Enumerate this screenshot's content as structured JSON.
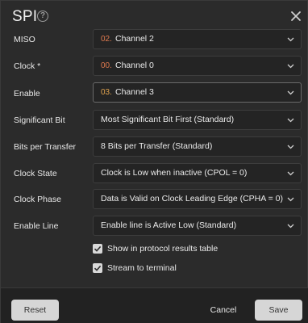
{
  "dialog": {
    "title": "SPI",
    "help_icon": "help-circle-icon",
    "close_icon": "close-icon"
  },
  "fields": {
    "miso": {
      "label": "MISO",
      "number": "02.",
      "value": "Channel 2"
    },
    "clock": {
      "label": "Clock *",
      "number": "00.",
      "value": "Channel 0"
    },
    "enable": {
      "label": "Enable",
      "number": "03.",
      "value": "Channel 3"
    },
    "significant_bit": {
      "label": "Significant Bit",
      "value": "Most Significant Bit First (Standard)"
    },
    "bits_per_transfer": {
      "label": "Bits per Transfer",
      "value": "8 Bits per Transfer (Standard)"
    },
    "clock_state": {
      "label": "Clock State",
      "value": "Clock is Low when inactive (CPOL = 0)"
    },
    "clock_phase": {
      "label": "Clock Phase",
      "value": "Data is Valid on Clock Leading Edge (CPHA = 0)"
    },
    "enable_line": {
      "label": "Enable Line",
      "value": "Enable line is Active Low (Standard)"
    }
  },
  "checkboxes": {
    "show_results": {
      "label": "Show in protocol results table",
      "checked": true
    },
    "stream_terminal": {
      "label": "Stream to terminal",
      "checked": true
    }
  },
  "footer": {
    "reset_label": "Reset",
    "cancel_label": "Cancel",
    "save_label": "Save"
  },
  "colors": {
    "channel_2": "#e07a4f",
    "channel_0": "#e07a4f",
    "channel_3": "#e0a34f",
    "background": "#2b2b2b"
  }
}
